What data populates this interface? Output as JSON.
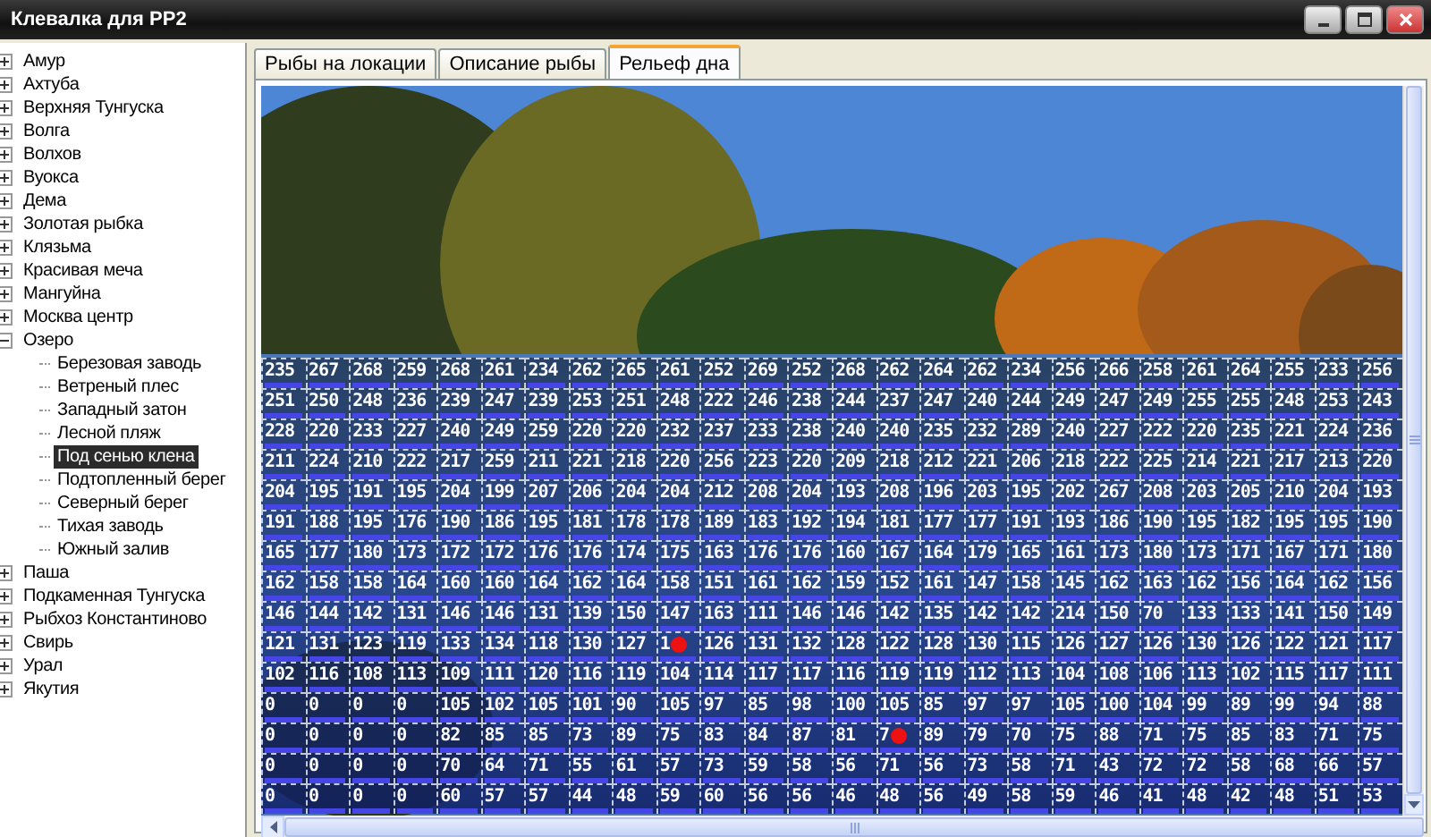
{
  "window": {
    "title": "Клевалка для РР2"
  },
  "sidebar": {
    "items": [
      {
        "label": "Амур",
        "expanded": false,
        "selected": false
      },
      {
        "label": "Ахтуба",
        "expanded": false,
        "selected": false
      },
      {
        "label": "Верхняя Тунгуска",
        "expanded": false,
        "selected": false
      },
      {
        "label": "Волга",
        "expanded": false,
        "selected": false
      },
      {
        "label": "Волхов",
        "expanded": false,
        "selected": false
      },
      {
        "label": "Вуокса",
        "expanded": false,
        "selected": false
      },
      {
        "label": "Дема",
        "expanded": false,
        "selected": false
      },
      {
        "label": "Золотая рыбка",
        "expanded": false,
        "selected": false
      },
      {
        "label": "Клязьма",
        "expanded": false,
        "selected": false
      },
      {
        "label": "Красивая меча",
        "expanded": false,
        "selected": false
      },
      {
        "label": "Мангуйна",
        "expanded": false,
        "selected": false
      },
      {
        "label": "Москва центр",
        "expanded": false,
        "selected": false
      },
      {
        "label": "Озеро",
        "expanded": true,
        "selected": false,
        "children": [
          {
            "label": "Березовая заводь",
            "selected": false
          },
          {
            "label": "Ветреный плес",
            "selected": false
          },
          {
            "label": "Западный затон",
            "selected": false
          },
          {
            "label": "Лесной пляж",
            "selected": false
          },
          {
            "label": "Под сенью клена",
            "selected": true
          },
          {
            "label": "Подтопленный берег",
            "selected": false
          },
          {
            "label": "Северный берег",
            "selected": false
          },
          {
            "label": "Тихая заводь",
            "selected": false
          },
          {
            "label": "Южный залив",
            "selected": false
          }
        ]
      },
      {
        "label": "Паша",
        "expanded": false,
        "selected": false
      },
      {
        "label": "Подкаменная Тунгуска",
        "expanded": false,
        "selected": false
      },
      {
        "label": "Рыбхоз Константиново",
        "expanded": false,
        "selected": false
      },
      {
        "label": "Свирь",
        "expanded": false,
        "selected": false
      },
      {
        "label": "Урал",
        "expanded": false,
        "selected": false
      },
      {
        "label": "Якутия",
        "expanded": false,
        "selected": false
      }
    ]
  },
  "tabs": [
    {
      "label": "Рыбы на локации",
      "selected": false
    },
    {
      "label": "Описание рыбы",
      "selected": false
    },
    {
      "label": "Рельеф дна",
      "selected": true
    }
  ],
  "depth_grid": {
    "rows": [
      [
        "235",
        "267",
        "268",
        "259",
        "268",
        "261",
        "234",
        "262",
        "265",
        "261",
        "252",
        "269",
        "252",
        "268",
        "262",
        "264",
        "262",
        "234",
        "256",
        "266",
        "258",
        "261",
        "264",
        "255",
        "233",
        "256"
      ],
      [
        "251",
        "250",
        "248",
        "236",
        "239",
        "247",
        "239",
        "253",
        "251",
        "248",
        "222",
        "246",
        "238",
        "244",
        "237",
        "247",
        "240",
        "244",
        "249",
        "247",
        "249",
        "255",
        "255",
        "248",
        "253",
        "243"
      ],
      [
        "228",
        "220",
        "233",
        "227",
        "240",
        "249",
        "259",
        "220",
        "220",
        "232",
        "237",
        "233",
        "238",
        "240",
        "240",
        "235",
        "232",
        "289",
        "240",
        "227",
        "222",
        "220",
        "235",
        "221",
        "224",
        "236"
      ],
      [
        "211",
        "224",
        "210",
        "222",
        "217",
        "259",
        "211",
        "221",
        "218",
        "220",
        "256",
        "223",
        "220",
        "209",
        "218",
        "212",
        "221",
        "206",
        "218",
        "222",
        "225",
        "214",
        "221",
        "217",
        "213",
        "220"
      ],
      [
        "204",
        "195",
        "191",
        "195",
        "204",
        "199",
        "207",
        "206",
        "204",
        "204",
        "212",
        "208",
        "204",
        "193",
        "208",
        "196",
        "203",
        "195",
        "202",
        "267",
        "208",
        "203",
        "205",
        "210",
        "204",
        "193"
      ],
      [
        "191",
        "188",
        "195",
        "176",
        "190",
        "186",
        "195",
        "181",
        "178",
        "178",
        "189",
        "183",
        "192",
        "194",
        "181",
        "177",
        "177",
        "191",
        "193",
        "186",
        "190",
        "195",
        "182",
        "195",
        "195",
        "190"
      ],
      [
        "165",
        "177",
        "180",
        "173",
        "172",
        "172",
        "176",
        "176",
        "174",
        "175",
        "163",
        "176",
        "176",
        "160",
        "167",
        "164",
        "179",
        "165",
        "161",
        "173",
        "180",
        "173",
        "171",
        "167",
        "171",
        "180"
      ],
      [
        "162",
        "158",
        "158",
        "164",
        "160",
        "160",
        "164",
        "162",
        "164",
        "158",
        "151",
        "161",
        "162",
        "159",
        "152",
        "161",
        "147",
        "158",
        "145",
        "162",
        "163",
        "162",
        "156",
        "164",
        "162",
        "156"
      ],
      [
        "146",
        "144",
        "142",
        "131",
        "146",
        "146",
        "131",
        "139",
        "150",
        "147",
        "163",
        "111",
        "146",
        "146",
        "142",
        "135",
        "142",
        "142",
        "214",
        "150",
        "70",
        "133",
        "133",
        "141",
        "150",
        "149"
      ],
      [
        "121",
        "131",
        "123",
        "119",
        "133",
        "134",
        "118",
        "130",
        "127",
        {
          "value": "1",
          "marker": true
        },
        "126",
        "131",
        "132",
        "128",
        "122",
        "128",
        "130",
        "115",
        "126",
        "127",
        "126",
        "130",
        "126",
        "122",
        "121",
        "117"
      ],
      [
        "102",
        "116",
        "108",
        "113",
        "109",
        "111",
        "120",
        "116",
        "119",
        "104",
        "114",
        "117",
        "117",
        "116",
        "119",
        "119",
        "112",
        "113",
        "104",
        "108",
        "106",
        "113",
        "102",
        "115",
        "117",
        "111"
      ],
      [
        "0",
        "0",
        "0",
        "0",
        "105",
        "102",
        "105",
        "101",
        "90",
        "105",
        "97",
        "85",
        "98",
        "100",
        "105",
        "85",
        "97",
        "97",
        "105",
        "100",
        "104",
        "99",
        "89",
        "99",
        "94",
        "88"
      ],
      [
        "0",
        "0",
        "0",
        "0",
        "82",
        "85",
        "85",
        "73",
        "89",
        "75",
        "83",
        "84",
        "87",
        "81",
        {
          "value": "7",
          "marker": true
        },
        "89",
        "79",
        "70",
        "75",
        "88",
        "71",
        "75",
        "85",
        "83",
        "71",
        "75"
      ],
      [
        "0",
        "0",
        "0",
        "0",
        "70",
        "64",
        "71",
        "55",
        "61",
        "57",
        "73",
        "59",
        "58",
        "56",
        "71",
        "56",
        "73",
        "58",
        "71",
        "43",
        "72",
        "72",
        "58",
        "68",
        "66",
        "57"
      ],
      [
        "0",
        "0",
        "0",
        "0",
        "60",
        "57",
        "57",
        "44",
        "48",
        "59",
        "60",
        "56",
        "56",
        "46",
        "48",
        "56",
        "49",
        "58",
        "59",
        "46",
        "41",
        "48",
        "42",
        "48",
        "51",
        "53"
      ]
    ]
  }
}
